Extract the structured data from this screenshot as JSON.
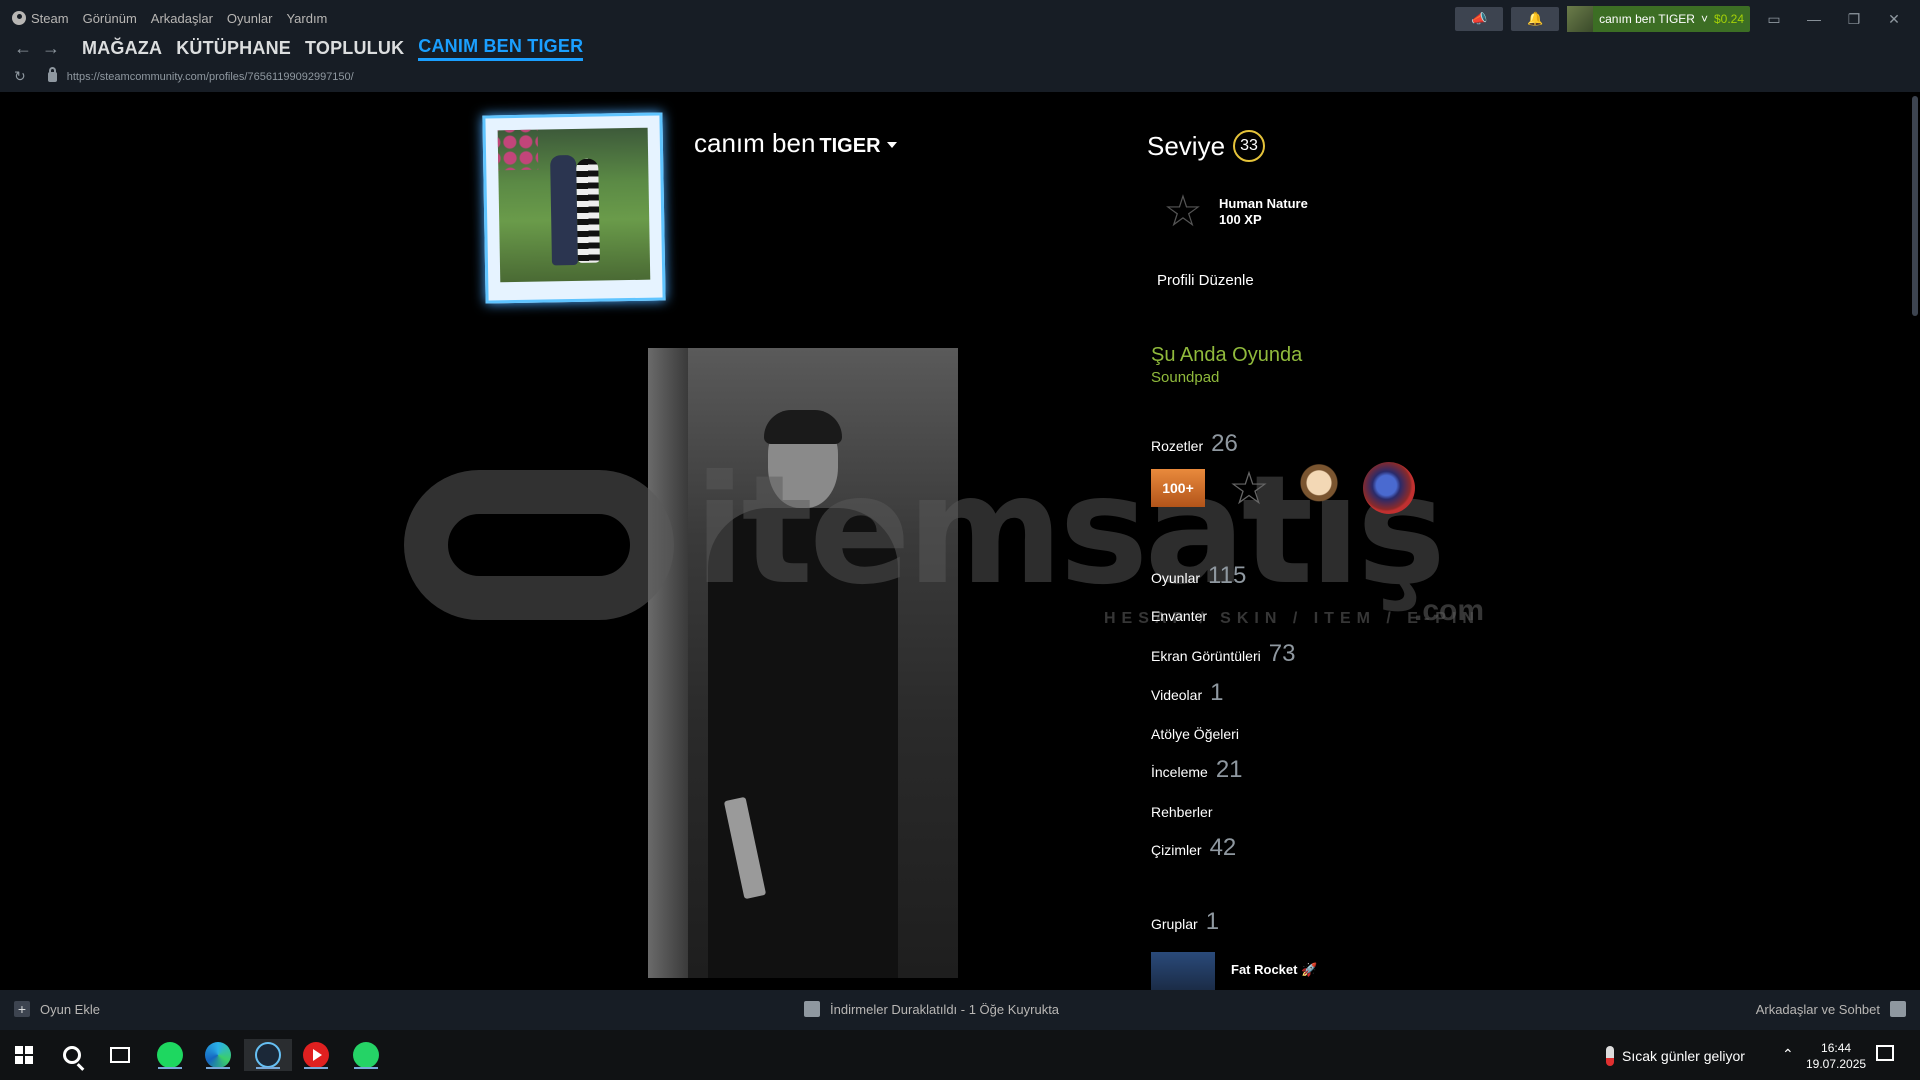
{
  "menu": {
    "steam": "Steam",
    "view": "Görünüm",
    "friends": "Arkadaşlar",
    "games": "Oyunlar",
    "help": "Yardım"
  },
  "nav": {
    "store": "MAĞAZA",
    "library": "KÜTÜPHANE",
    "community": "TOPLULUK",
    "profile": "CANIM BEN TIGER"
  },
  "url": "https://steamcommunity.com/profiles/76561199092997150/",
  "account": {
    "name": "canım ben TIGER",
    "balance": "$0.24"
  },
  "profile": {
    "persona_first": "canım ben",
    "persona_second": "TIGER",
    "level_label": "Seviye",
    "level": "33",
    "fav_badge_name": "Human Nature",
    "fav_badge_xp": "100 XP",
    "edit_profile": "Profili Düzenle",
    "ingame_label": "Şu Anda Oyunda",
    "ingame_game": "Soundpad"
  },
  "stats": {
    "badges_label": "Rozetler",
    "badges_count": "26",
    "games_label": "Oyunlar",
    "games_count": "115",
    "inventory_label": "Envanter",
    "screenshots_label": "Ekran Görüntüleri",
    "screenshots_count": "73",
    "videos_label": "Videolar",
    "videos_count": "1",
    "workshop_label": "Atölye Öğeleri",
    "reviews_label": "İnceleme",
    "reviews_count": "21",
    "guides_label": "Rehberler",
    "artwork_label": "Çizimler",
    "artwork_count": "42",
    "groups_label": "Gruplar",
    "groups_count": "1"
  },
  "badge1_text": "100+",
  "group": {
    "name": "Fat Rocket 🚀"
  },
  "watermark": {
    "text": "itemsatış",
    "sub": "HESAP / SKIN / ITEM / E-PIN",
    "com": ".com"
  },
  "bottom": {
    "add_game": "Oyun Ekle",
    "downloads": "İndirmeler Duraklatıldı - 1 Öğe Kuyrukta",
    "friends_chat": "Arkadaşlar ve Sohbet"
  },
  "taskbar": {
    "weather": "Sıcak günler geliyor",
    "time": "16:44",
    "date": "19.07.2025"
  },
  "colors": {
    "accent": "#1a9fff",
    "ingame": "#90ba3c",
    "level_ring": "#e5c33a"
  }
}
